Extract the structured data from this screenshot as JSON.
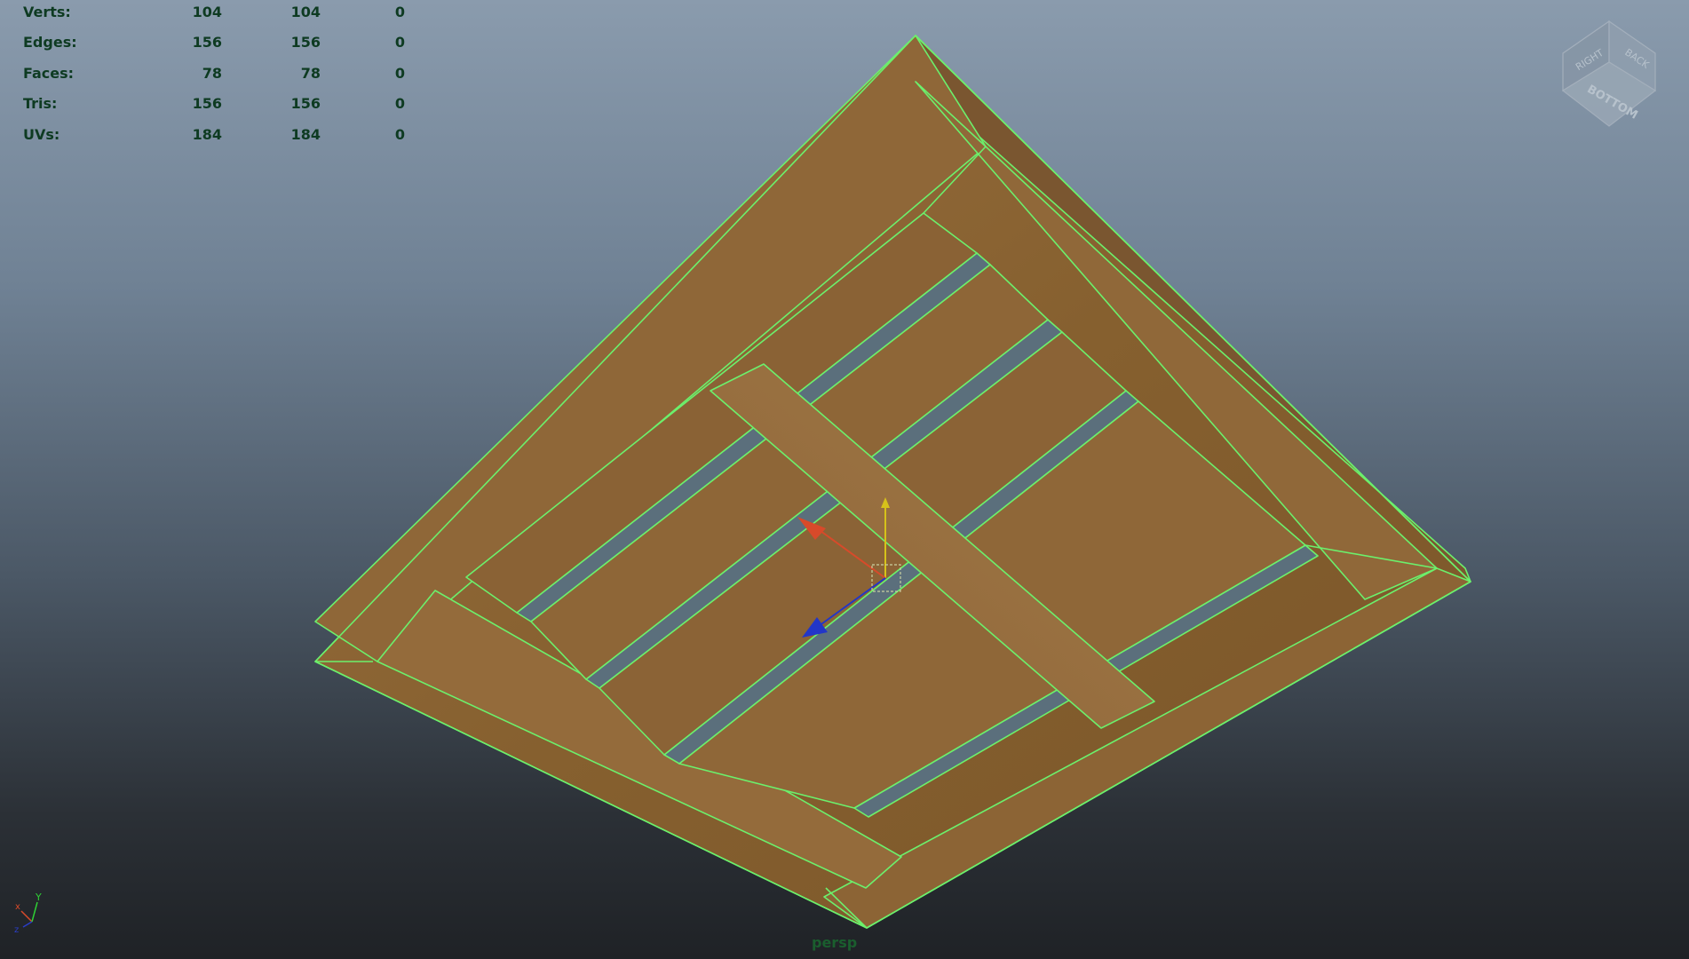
{
  "hud": {
    "rows": [
      {
        "label": "Verts:",
        "v1": "104",
        "v2": "104",
        "v3": "0"
      },
      {
        "label": "Edges:",
        "v1": "156",
        "v2": "156",
        "v3": "0"
      },
      {
        "label": "Faces:",
        "v1": "78",
        "v2": "78",
        "v3": "0"
      },
      {
        "label": "Tris:",
        "v1": "156",
        "v2": "156",
        "v3": "0"
      },
      {
        "label": "UVs:",
        "v1": "184",
        "v2": "184",
        "v3": "0"
      }
    ]
  },
  "viewcube": {
    "faces": {
      "right": "RIGHT",
      "back": "BACK",
      "bottom": "BOTTOM"
    }
  },
  "axis": {
    "x": "x",
    "y": "Y",
    "z": "z"
  },
  "camera": {
    "name": "persp"
  },
  "colors": {
    "wireframe": "#6cf06c",
    "wood": "#8a6236",
    "wood_dark": "#6d4a28",
    "hud_text": "#0e3b22"
  }
}
